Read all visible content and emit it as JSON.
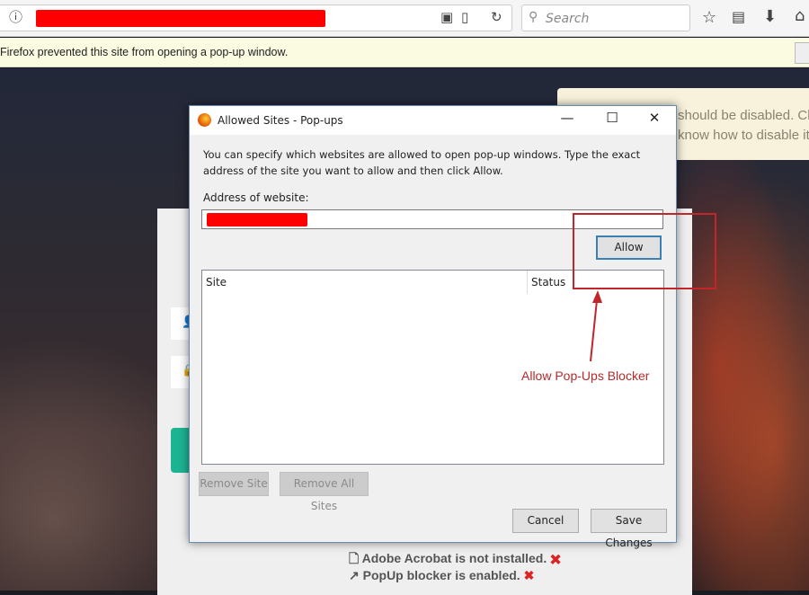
{
  "browser": {
    "search_placeholder": "Search",
    "notification": "Firefox prevented this site from opening a pop-up window."
  },
  "page": {
    "notice_line1": "should be disabled. Clic",
    "notice_line2": "know how to disable it.",
    "status": [
      {
        "text": "Adobe Acrobat is not installed.",
        "icon": "pdf-file-icon"
      },
      {
        "text": "PopUp blocker is enabled.",
        "icon": "external-link-icon"
      }
    ]
  },
  "dialog": {
    "title": "Allowed Sites - Pop-ups",
    "description": "You can specify which websites are allowed to open pop-up windows. Type the exact address of the site you want to allow and then click Allow.",
    "address_label": "Address of website:",
    "allow": "Allow",
    "columns": [
      "Site",
      "Status"
    ],
    "remove_site": "Remove Site",
    "remove_all": "Remove All Sites",
    "cancel": "Cancel",
    "save": "Save Changes"
  },
  "annotation": {
    "label": "Allow Pop-Ups Blocker",
    "color": "#c0262a"
  }
}
